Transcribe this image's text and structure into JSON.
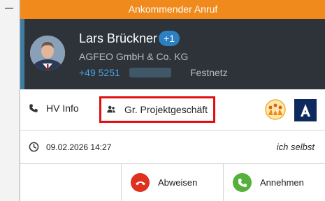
{
  "window": {
    "title": "Ankommender Anruf"
  },
  "caller": {
    "name": "Lars Brückner",
    "badge": "+1",
    "company": "AGFEO GmbH & Co. KG",
    "phone": "+49 5251",
    "phone_type": "Festnetz",
    "avatar_icon": "person-photo"
  },
  "info": {
    "hv_label": "HV Info",
    "hv_icon": "phone-icon",
    "project_label": "Gr. Projektgeschäft",
    "project_icon": "people-icon"
  },
  "call": {
    "datetime": "09.02.2026 14:27",
    "handler": "ich selbst",
    "clock_icon": "clock-icon"
  },
  "actions": {
    "reject_label": "Abweisen",
    "accept_label": "Annehmen"
  },
  "colors": {
    "titlebar": "#f08a1c",
    "caller_bg": "#2d3339",
    "highlight": "#e01010",
    "reject": "#e0301e",
    "accept": "#55b03c",
    "link": "#4ea1e2"
  }
}
